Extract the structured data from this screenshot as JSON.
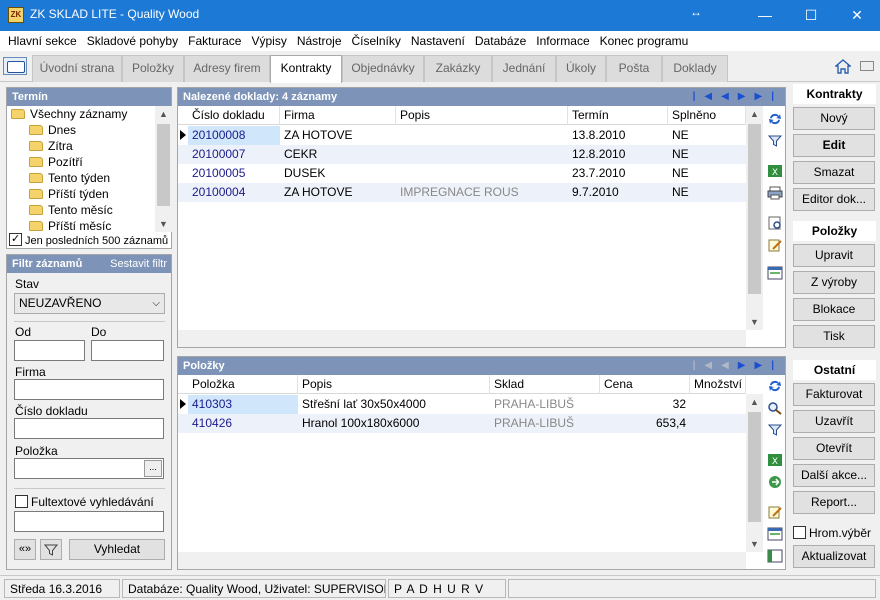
{
  "window": {
    "title": "ZK SKLAD LITE - Quality Wood",
    "icon_text": "ZK",
    "controls": {
      "minimize": "—",
      "maximize": "☐",
      "close": "✕"
    }
  },
  "menu": [
    "Hlavní sekce",
    "Skladové pohyby",
    "Fakturace",
    "Výpisy",
    "Nástroje",
    "Číselníky",
    "Nastavení",
    "Databáze",
    "Informace",
    "Konec programu"
  ],
  "tabs": [
    {
      "label": "Úvodní strana",
      "active": false
    },
    {
      "label": "Položky",
      "active": false
    },
    {
      "label": "Adresy firem",
      "active": false
    },
    {
      "label": "Kontrakty",
      "active": true
    },
    {
      "label": "Objednávky",
      "active": false
    },
    {
      "label": "Zakázky",
      "active": false
    },
    {
      "label": "Jednání",
      "active": false
    },
    {
      "label": "Úkoly",
      "active": false
    },
    {
      "label": "Pošta",
      "active": false
    },
    {
      "label": "Doklady",
      "active": false
    }
  ],
  "termin": {
    "title": "Termín",
    "items": [
      "Všechny záznamy",
      "Dnes",
      "Zítra",
      "Pozítří",
      "Tento týden",
      "Příští týden",
      "Tento měsíc",
      "Příští měsíc"
    ],
    "last500_label": "Jen posledních 500 záznamů",
    "last500_checked": true
  },
  "filter": {
    "title": "Filtr záznamů",
    "build_link": "Sestavit filtr",
    "stav_label": "Stav",
    "stav_value": "NEUZAVŘENO",
    "od_label": "Od",
    "do_label": "Do",
    "firma_label": "Firma",
    "cislo_label": "Číslo dokladu",
    "polozka_label": "Položka",
    "ellipsis": "...",
    "fulltext_label": "Fultextové vyhledávání",
    "expand_btn": "«»",
    "search_btn": "Vyhledat"
  },
  "docs": {
    "title": "Nalezené doklady: 4 záznamy",
    "columns": [
      "Číslo dokladu",
      "Firma",
      "Popis",
      "Termín",
      "Splněno"
    ],
    "rows": [
      [
        "20100008",
        "ZA HOTOVE",
        "",
        "13.8.2010",
        "NE"
      ],
      [
        "20100007",
        "CEKR",
        "",
        "12.8.2010",
        "NE"
      ],
      [
        "20100005",
        "DUSEK",
        "",
        "23.7.2010",
        "NE"
      ],
      [
        "20100004",
        "ZA HOTOVE",
        "IMPREGNACE ROUS",
        "9.7.2010",
        "NE"
      ]
    ]
  },
  "items": {
    "title": "Položky",
    "columns": [
      "Položka",
      "Popis",
      "Sklad",
      "Cena",
      "Množství"
    ],
    "rows": [
      [
        "410303",
        "Střešní lať 30x50x4000",
        "PRAHA-LIBUŠ",
        "32",
        ""
      ],
      [
        "410426",
        "Hranol 100x180x6000",
        "PRAHA-LIBUŠ",
        "653,4",
        ""
      ]
    ]
  },
  "right": {
    "kontrakty_head": "Kontrakty",
    "kontrakty": [
      "Nový",
      "Edit",
      "Smazat",
      "Editor dok..."
    ],
    "polozky_head": "Položky",
    "polozky": [
      "Upravit",
      "Z výroby",
      "Blokace",
      "Tisk"
    ],
    "ostatni_head": "Ostatní",
    "ostatni": [
      "Fakturovat",
      "Uzavřít",
      "Otevřít",
      "Další akce...",
      "Report..."
    ],
    "hrom_label": "Hrom.výběr",
    "refresh_btn": "Aktualizovat"
  },
  "status": {
    "date": "Středa 16.3.2016",
    "db": "Databáze: Quality Wood, Uživatel: SUPERVISOR",
    "flags": "P A D H U R V"
  },
  "colors": {
    "titlebar": "#1c79d6",
    "panel_header": "#7d94b8",
    "link_blue": "#1b1b8c",
    "nav_arrow": "#1a4fd0"
  }
}
